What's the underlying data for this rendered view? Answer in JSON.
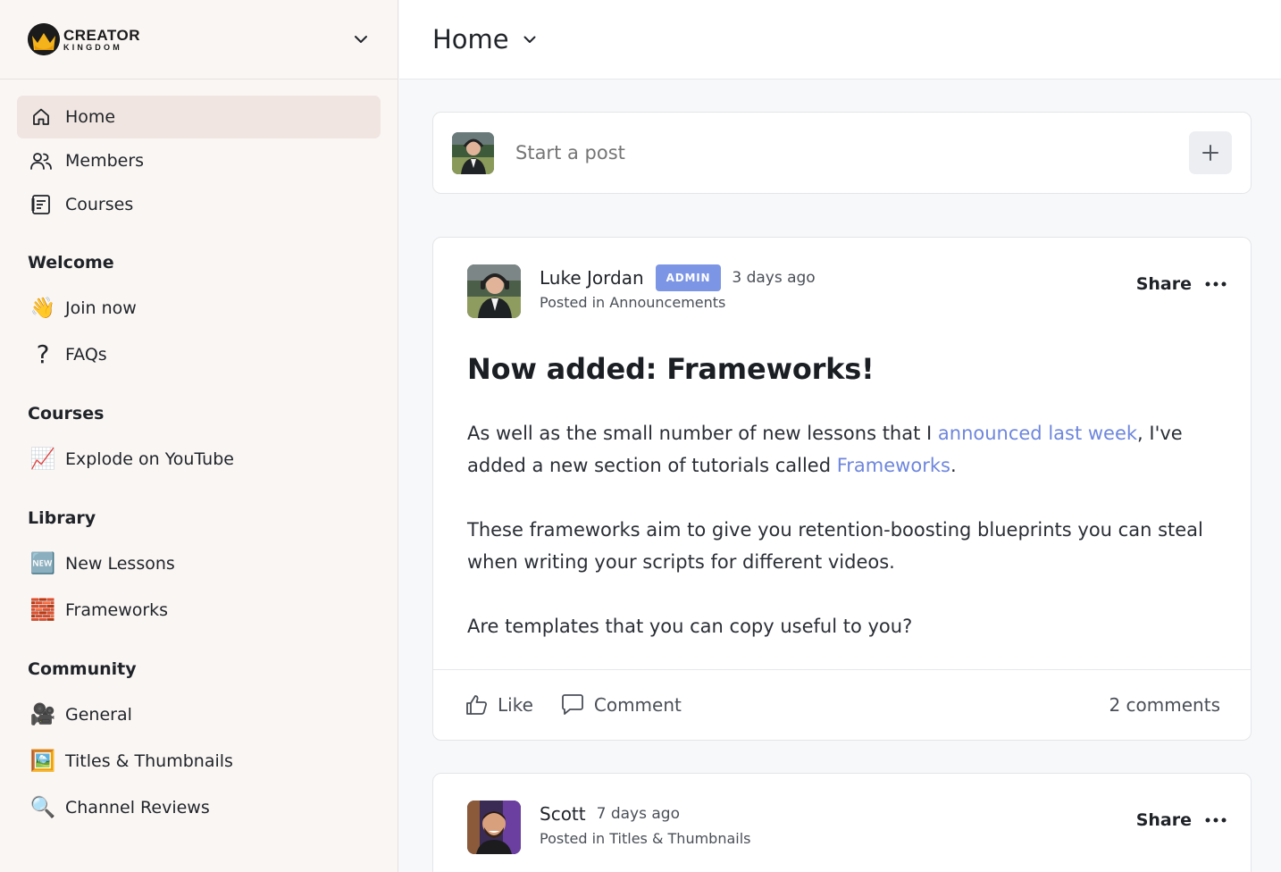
{
  "brand": {
    "name_top": "CREATOR",
    "name_bottom": "KINGDOM"
  },
  "sidebar": {
    "primary": [
      {
        "label": "Home",
        "icon": "home-icon",
        "active": true
      },
      {
        "label": "Members",
        "icon": "members-icon"
      },
      {
        "label": "Courses",
        "icon": "courses-icon"
      }
    ],
    "sections": [
      {
        "title": "Welcome",
        "items": [
          {
            "label": "Join now",
            "emoji": "👋"
          },
          {
            "label": "FAQs",
            "emoji": "?"
          }
        ]
      },
      {
        "title": "Courses",
        "items": [
          {
            "label": "Explode on YouTube",
            "emoji": "📈"
          }
        ]
      },
      {
        "title": "Library",
        "items": [
          {
            "label": "New Lessons",
            "emoji": "🆕"
          },
          {
            "label": "Frameworks",
            "emoji": "🧱"
          }
        ]
      },
      {
        "title": "Community",
        "items": [
          {
            "label": "General",
            "emoji": "🎥"
          },
          {
            "label": "Titles & Thumbnails",
            "emoji": "🖼️"
          },
          {
            "label": "Channel Reviews",
            "emoji": "🔍"
          }
        ]
      }
    ]
  },
  "topbar": {
    "title": "Home"
  },
  "composer": {
    "placeholder": "Start a post"
  },
  "posts": [
    {
      "author": "Luke Jordan",
      "badge": "ADMIN",
      "time": "3 days ago",
      "posted_in_prefix": "Posted in",
      "space": "Announcements",
      "share_label": "Share",
      "title": "Now added: Frameworks!",
      "body": {
        "p1_a": "As well as the small number of new lessons that I ",
        "p1_link1": "announced last week",
        "p1_b": ", I've added a new section of tutorials called ",
        "p1_link2": "Frameworks",
        "p1_c": ".",
        "p2": "These frameworks aim to give you retention-boosting blueprints you can steal when writing your scripts for different videos.",
        "p3": "Are templates that you can copy useful to you?"
      },
      "like_label": "Like",
      "comment_label": "Comment",
      "comments_count": "2 comments"
    },
    {
      "author": "Scott",
      "time": "7 days ago",
      "posted_in_prefix": "Posted in",
      "space": "Titles & Thumbnails",
      "share_label": "Share"
    }
  ],
  "colors": {
    "accent": "#7c95e4",
    "link": "#6e86dd",
    "sidebar_bg": "#faf6f4",
    "active_bg": "#f0e5e0"
  }
}
